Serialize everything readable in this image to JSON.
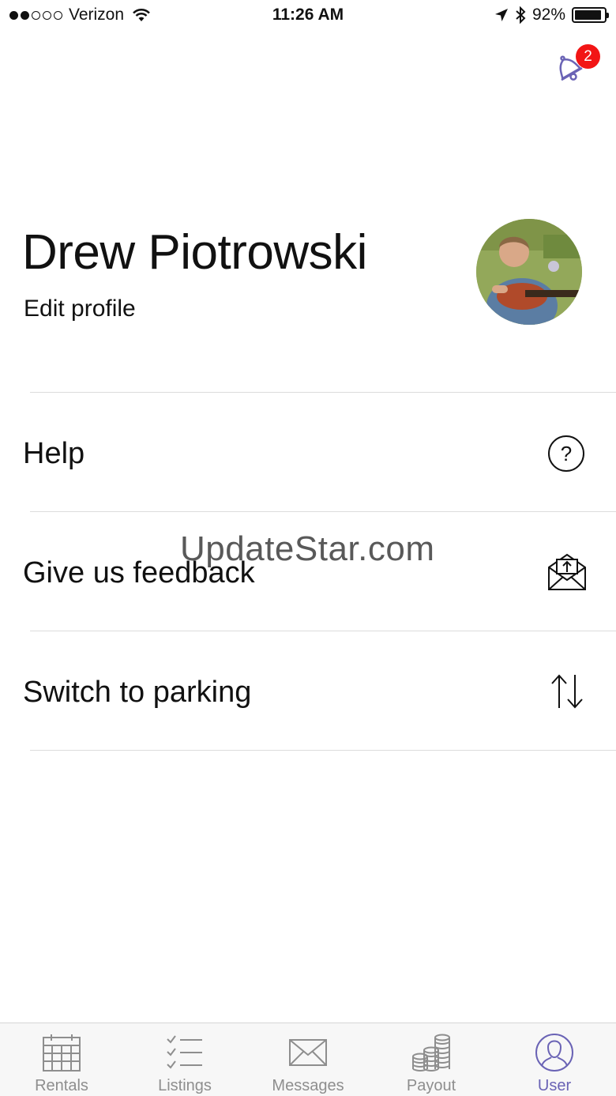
{
  "status_bar": {
    "carrier": "Verizon",
    "time": "11:26 AM",
    "battery": "92%",
    "battery_level": 0.92,
    "signal_bars": 2
  },
  "header": {
    "bell_icon": "bell-icon",
    "notification_count": "2"
  },
  "profile": {
    "name": "Drew Piotrowski",
    "edit_label": "Edit profile"
  },
  "menu": {
    "items": [
      {
        "label": "Help",
        "icon": "question-circle-icon"
      },
      {
        "label": "Give us feedback",
        "icon": "envelope-upload-icon"
      },
      {
        "label": "Switch to parking",
        "icon": "swap-arrows-icon"
      }
    ]
  },
  "watermark": "UpdateStar.com",
  "tab_bar": {
    "tabs": [
      {
        "label": "Rentals",
        "icon": "calendar-icon",
        "active": false
      },
      {
        "label": "Listings",
        "icon": "checklist-icon",
        "active": false
      },
      {
        "label": "Messages",
        "icon": "envelope-icon",
        "active": false
      },
      {
        "label": "Payout",
        "icon": "coins-icon",
        "active": false
      },
      {
        "label": "User",
        "icon": "user-icon",
        "active": true
      }
    ]
  },
  "colors": {
    "accent": "#6a63b5",
    "badge": "#f21515",
    "inactive_tab": "#8e8e8e"
  }
}
